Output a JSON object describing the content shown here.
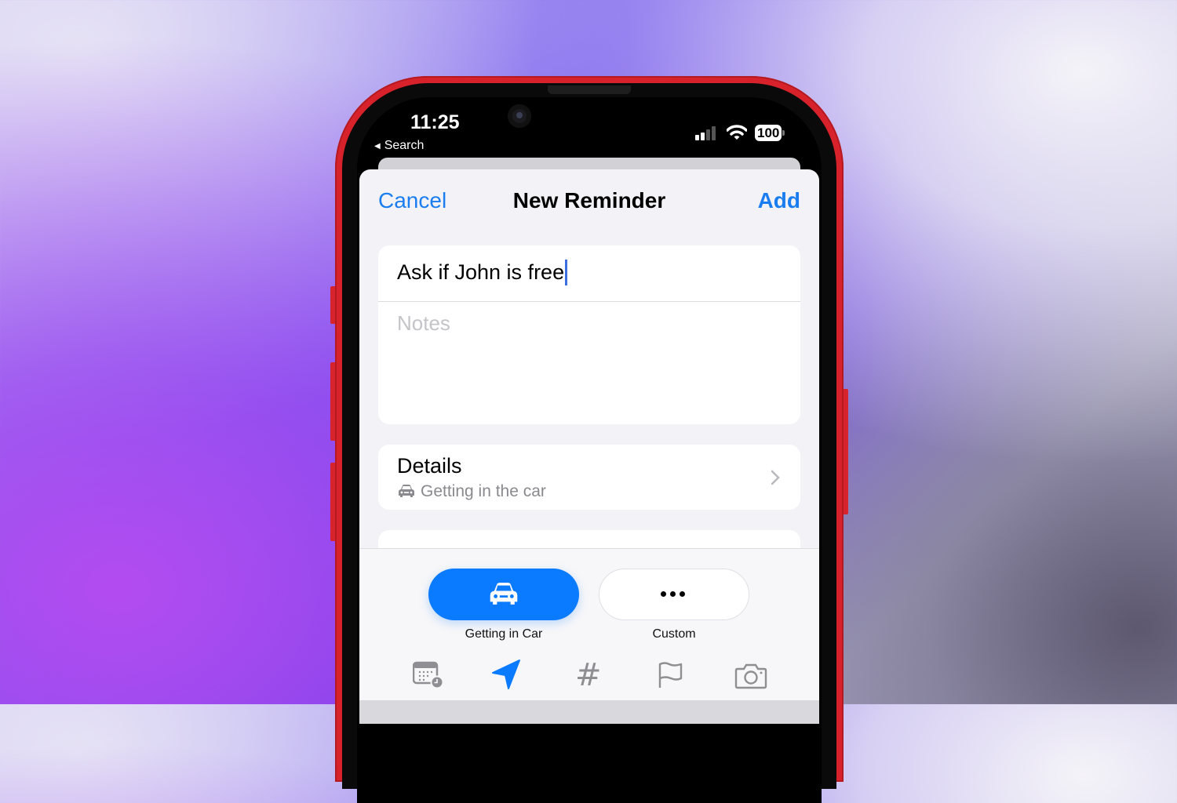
{
  "status_bar": {
    "time": "11:25",
    "back_label": "Search",
    "battery": "100"
  },
  "header": {
    "cancel": "Cancel",
    "title": "New Reminder",
    "add": "Add"
  },
  "reminder": {
    "title_value": "Ask if John is free",
    "notes_placeholder": "Notes"
  },
  "details": {
    "label": "Details",
    "subtitle": "Getting in the car",
    "icon": "car-icon"
  },
  "quick_options": [
    {
      "label": "Getting in Car",
      "icon": "car-icon",
      "selected": true
    },
    {
      "label": "Custom",
      "icon": "ellipsis-icon",
      "selected": false
    }
  ],
  "toolbar": [
    "calendar-clock-icon",
    "location-arrow-icon",
    "hashtag-icon",
    "flag-icon",
    "camera-icon"
  ],
  "colors": {
    "accent": "#1a7df0",
    "frame": "#d8222b",
    "sheet": "#f2f2f7"
  }
}
